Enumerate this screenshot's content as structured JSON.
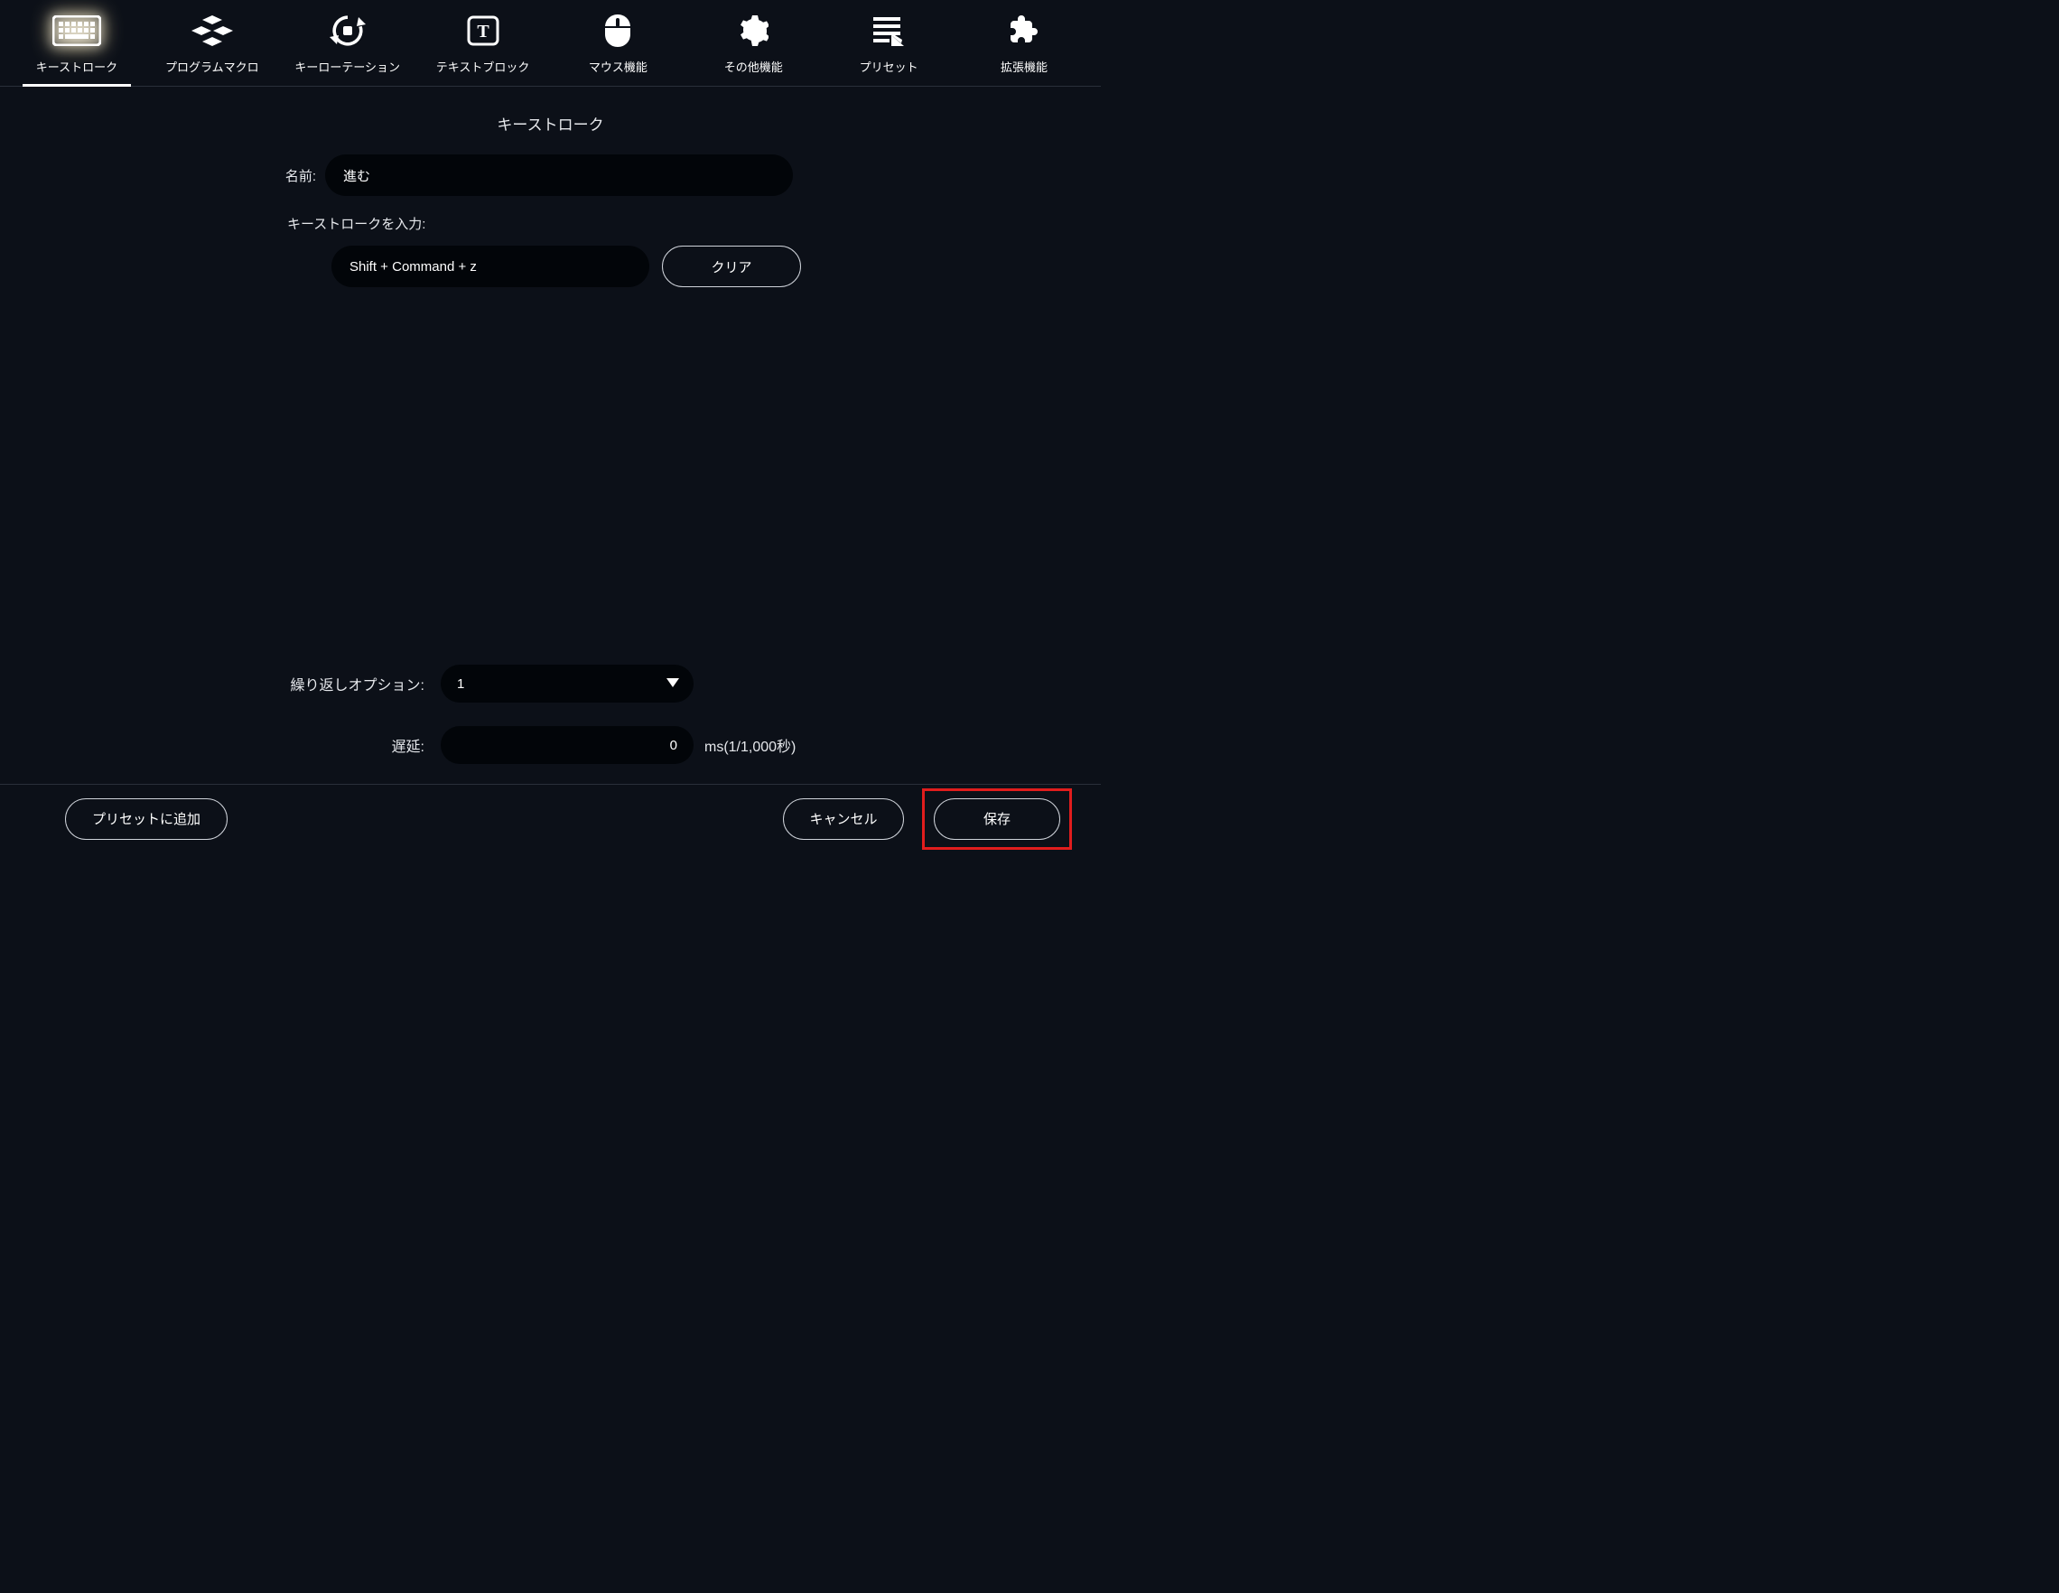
{
  "tabs": [
    {
      "label": "キーストローク"
    },
    {
      "label": "プログラムマクロ"
    },
    {
      "label": "キーローテーション"
    },
    {
      "label": "テキストブロック"
    },
    {
      "label": "マウス機能"
    },
    {
      "label": "その他機能"
    },
    {
      "label": "プリセット"
    },
    {
      "label": "拡張機能"
    }
  ],
  "section_title": "キーストローク",
  "name_label": "名前:",
  "name_value": "進む",
  "keystroke_prompt": "キーストロークを入力:",
  "keystroke_value": "Shift + Command + z",
  "clear_label": "クリア",
  "repeat_label": "繰り返しオプション:",
  "repeat_value": "1",
  "delay_label": "遅延:",
  "delay_value": "0",
  "delay_unit": "ms(1/1,000秒)",
  "footer": {
    "add_preset": "プリセットに追加",
    "cancel": "キャンセル",
    "save": "保存"
  }
}
